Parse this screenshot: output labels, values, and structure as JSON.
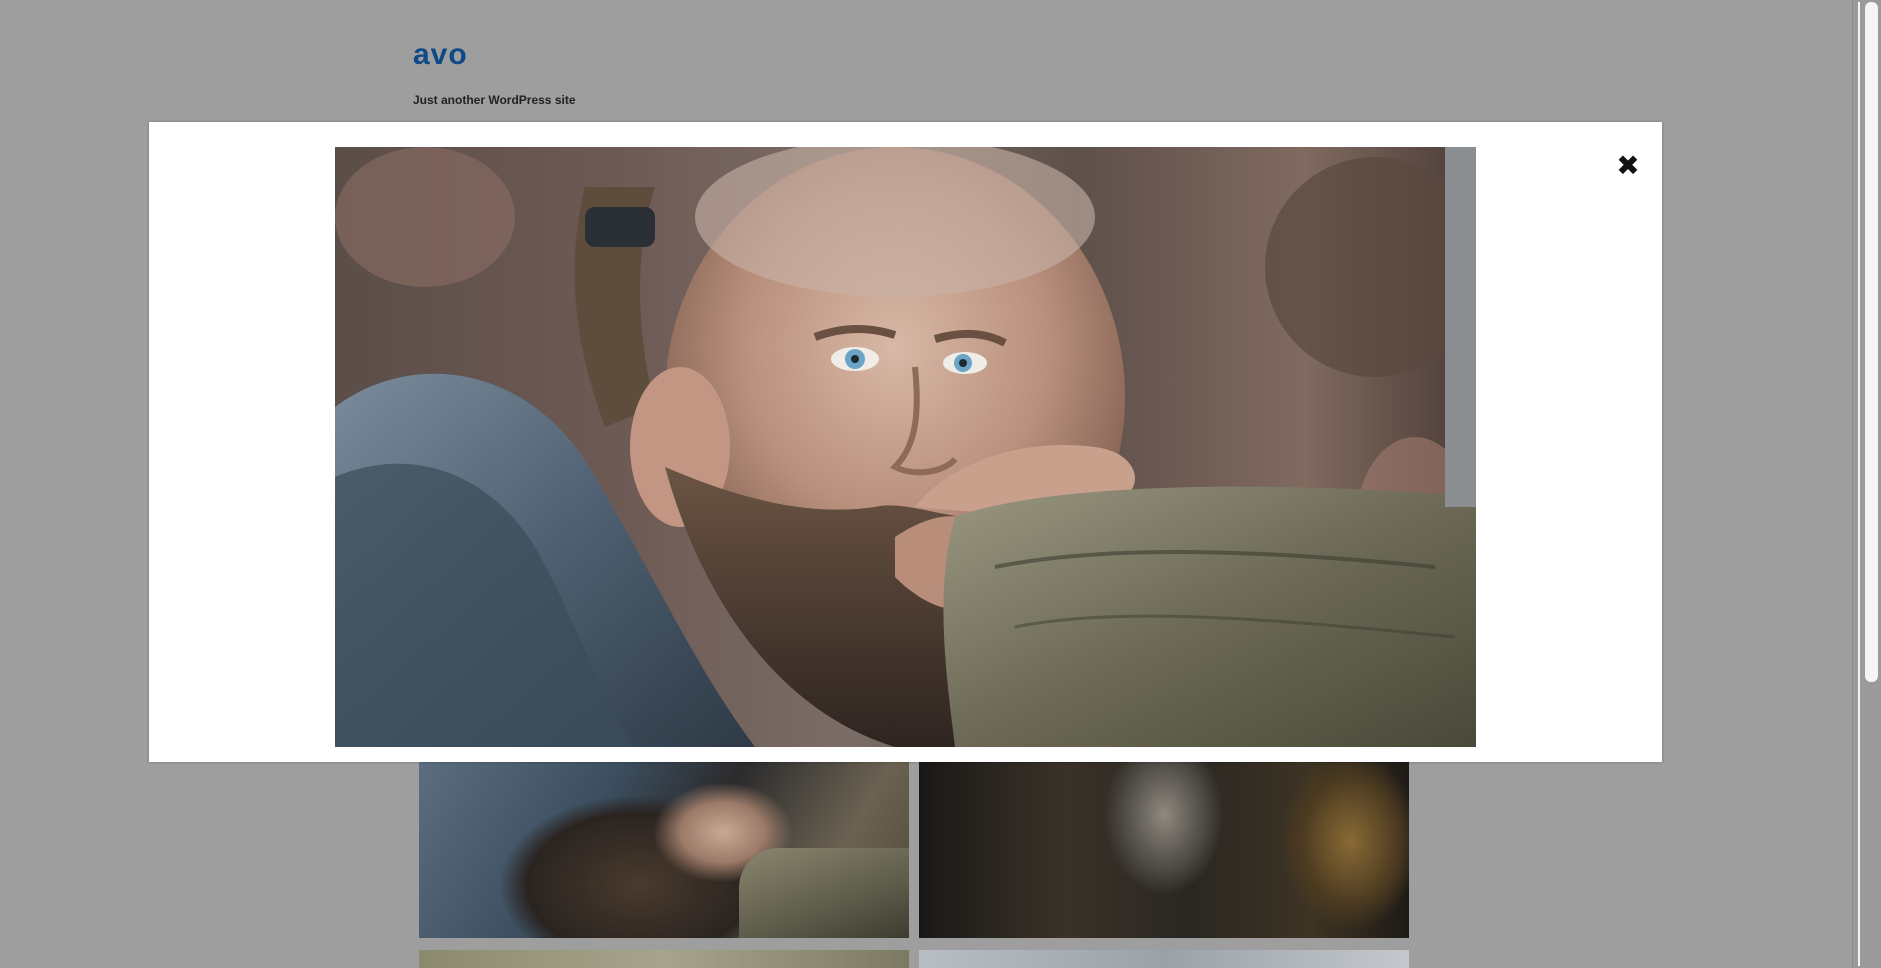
{
  "site": {
    "title": "avo",
    "tagline": "Just another WordPress site"
  },
  "lightbox": {
    "close_icon": "close-icon",
    "close_glyph": "✖",
    "image_subject": "bearded-man-portrait"
  },
  "gallery": {
    "thumbnails": [
      {
        "subject": "bearded-man-portrait"
      },
      {
        "subject": "group-of-women"
      },
      {
        "subject": "field-scene"
      },
      {
        "subject": "sky-scene"
      }
    ]
  },
  "colors": {
    "backdrop": "#9e9e9e",
    "site_title": "#0f4a86",
    "modal_bg": "#ffffff"
  }
}
